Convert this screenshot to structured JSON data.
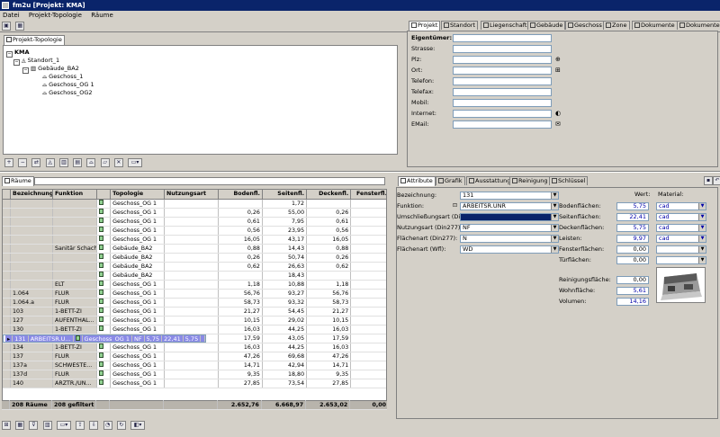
{
  "window": {
    "title": "fm2u [Projekt: KMA]"
  },
  "menu": [
    "Datei",
    "Projekt-Topologie",
    "Räume"
  ],
  "topology_panel": {
    "tab": "Projekt-Topologie",
    "tree": [
      {
        "label": "KMA",
        "level": 0,
        "bold": true
      },
      {
        "label": "Standort_1",
        "level": 1
      },
      {
        "label": "Gebäude_BA2",
        "level": 2
      },
      {
        "label": "Geschoss_1",
        "level": 3
      },
      {
        "label": "Geschoss_OG 1",
        "level": 3
      },
      {
        "label": "Geschoss_OG2",
        "level": 3
      }
    ]
  },
  "project_tabs": [
    "Projekt",
    "Standort",
    "Liegenschaft",
    "Gebäude",
    "Geschoss",
    "Zone",
    "Dokumente",
    "Dokumente"
  ],
  "project_form": {
    "fields": [
      {
        "label": "Eigentümer:",
        "value": "",
        "bold": true
      },
      {
        "label": "Strasse:",
        "value": ""
      },
      {
        "label": "Plz:",
        "value": ""
      },
      {
        "label": "Ort:",
        "value": ""
      },
      {
        "label": "Telefon:",
        "value": ""
      },
      {
        "label": "Telefax:",
        "value": ""
      },
      {
        "label": "Mobil:",
        "value": ""
      },
      {
        "label": "Internet:",
        "value": ""
      },
      {
        "label": "EMail:",
        "value": ""
      }
    ]
  },
  "rooms_panel": {
    "tab": "Räume",
    "columns": [
      "Bezeichnung",
      "Funktion",
      "",
      "Topologie",
      "Nutzungsart",
      "Bodenfl.",
      "Seitenfl.",
      "Deckenfl.",
      "Fensterfl."
    ],
    "rows": [
      [
        "",
        "",
        "Geschoss_OG 1",
        "",
        "",
        "1,72",
        ""
      ],
      [
        "",
        "",
        "Geschoss_OG 1",
        "",
        "0,26",
        "55,00",
        "0,26"
      ],
      [
        "",
        "",
        "Geschoss_OG 1",
        "",
        "0,61",
        "7,95",
        "0,61"
      ],
      [
        "",
        "",
        "Geschoss_OG 1",
        "",
        "0,56",
        "23,95",
        "0,56"
      ],
      [
        "",
        "",
        "Geschoss_OG 1",
        "",
        "16,05",
        "43,17",
        "16,05"
      ],
      [
        "",
        "Sanitär Schacht",
        "Gebäude_BA2",
        "",
        "0,88",
        "14,43",
        "0,88"
      ],
      [
        "",
        "",
        "Gebäude_BA2",
        "",
        "0,26",
        "50,74",
        "0,26"
      ],
      [
        "",
        "",
        "Gebäude_BA2",
        "",
        "0,62",
        "26,63",
        "0,62"
      ],
      [
        "",
        "",
        "Gebäude_BA2",
        "",
        "",
        "18,43",
        ""
      ],
      [
        "",
        "ELT",
        "Geschoss_OG 1",
        "",
        "1,18",
        "10,88",
        "1,18"
      ],
      [
        "1.064",
        "FLUR",
        "Geschoss_OG 1",
        "",
        "56,76",
        "93,27",
        "56,76"
      ],
      [
        "1.064.a",
        "FLUR",
        "Geschoss_OG 1",
        "",
        "58,73",
        "93,32",
        "58,73"
      ],
      [
        "103",
        "1-BETT-ZI",
        "Geschoss_OG 1",
        "",
        "21,27",
        "54,45",
        "21,27"
      ],
      [
        "127",
        "AUFENTHAL...",
        "Geschoss_OG 1",
        "",
        "10,15",
        "29,02",
        "10,15"
      ],
      [
        "130",
        "1-BETT-ZI",
        "Geschoss_OG 1",
        "",
        "16,03",
        "44,25",
        "16,03"
      ],
      [
        "131",
        "ARBEITSR.U...",
        "Geschoss_OG 1",
        "NF",
        "5,75",
        "22,41",
        "5,75"
      ],
      [
        "133",
        "UNTERS.",
        "Geschoss_OG 1",
        "",
        "17,59",
        "43,05",
        "17,59"
      ],
      [
        "134",
        "1-BETT-ZI",
        "Geschoss_OG 1",
        "",
        "16,03",
        "44,25",
        "16,03"
      ],
      [
        "137",
        "FLUR",
        "Geschoss_OG 1",
        "",
        "47,26",
        "69,68",
        "47,26"
      ],
      [
        "137a",
        "SCHWESTE...",
        "Geschoss_OG 1",
        "",
        "14,71",
        "42,94",
        "14,71"
      ],
      [
        "137d",
        "FLUR",
        "Geschoss_OG 1",
        "",
        "9,35",
        "18,80",
        "9,35"
      ],
      [
        "140",
        "ARZTR./UN...",
        "Geschoss_OG 1",
        "",
        "27,85",
        "73,54",
        "27,85"
      ]
    ],
    "selected_row": 15,
    "footer": {
      "count": "208 Räume",
      "filtered": "208 gefiltert",
      "bodenfl": "2.652,76",
      "seitenfl": "6.668,97",
      "deckenfl": "2.653,02",
      "fensterfl": "0,00"
    }
  },
  "room_tabs": [
    "Attribute",
    "Grafik",
    "Ausstattung",
    "Reinigung",
    "Schlüssel"
  ],
  "attributes": {
    "bezeichnung_label": "Bezeichnung:",
    "bezeichnung": "131",
    "funktion_label": "Funktion:",
    "funktion": "ARBEITSR.UNR",
    "umschliessung_label": "Umschließungsart (Din277):",
    "umschliessung": "",
    "nutzung_label": "Nutzungsart (Din277):",
    "nutzung": "NF",
    "flaechen_label": "Flächenart (Din277):",
    "flaechen": "N",
    "flaechen_wfl_label": "Flächenart (Wfl):",
    "flaechen_wfl": "WD",
    "wert_header": "Wert:",
    "material_header": "Material:",
    "measures": [
      {
        "label": "Bodenflächen:",
        "value": "5,75",
        "material": "cad",
        "blue": true
      },
      {
        "label": "Seitenflächen:",
        "value": "22,41",
        "material": "cad",
        "blue": true
      },
      {
        "label": "Deckenflächen:",
        "value": "5,75",
        "material": "cad",
        "blue": true
      },
      {
        "label": "Leisten:",
        "value": "9,97",
        "material": "cad",
        "blue": true
      },
      {
        "label": "Fensterflächen:",
        "value": "0,00",
        "material": "",
        "blue": false
      },
      {
        "label": "Türflächen:",
        "value": "0,00",
        "material": "",
        "blue": false
      }
    ],
    "extra": [
      {
        "label": "Reinigungsfläche:",
        "value": "0,00",
        "blue": false
      },
      {
        "label": "Wohnfläche:",
        "value": "5,61",
        "blue": true
      },
      {
        "label": "Volumen:",
        "value": "14,16",
        "blue": true
      }
    ]
  }
}
